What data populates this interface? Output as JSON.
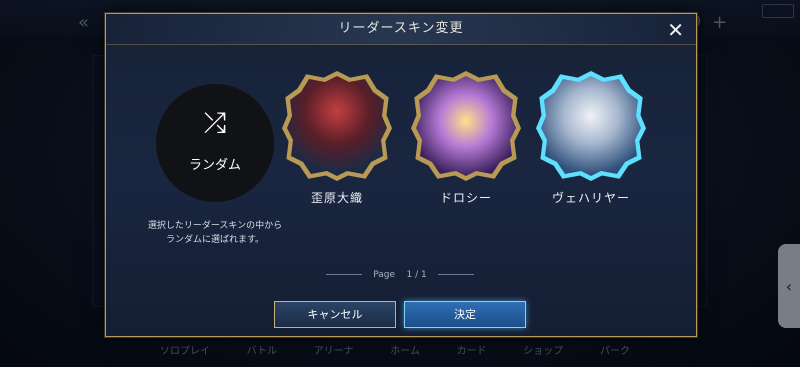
{
  "modal": {
    "title": "リーダースキン変更",
    "close_icon": "close-icon"
  },
  "options": [
    {
      "id": "random",
      "label": "ランダム",
      "icon": "shuffle-icon",
      "description": "選択したリーダースキンの中から\nランダムに選ばれます。"
    },
    {
      "id": "char1",
      "label": "歪原大織",
      "frame": "#b89a55",
      "selected": false
    },
    {
      "id": "char2",
      "label": "ドロシー",
      "frame": "#b89a55",
      "selected": false
    },
    {
      "id": "char3",
      "label": "ヴェハリヤー",
      "frame": "#5ee1ff",
      "selected": true
    }
  ],
  "pager": {
    "label": "Page",
    "current": "1",
    "sep": "/",
    "total": "1"
  },
  "buttons": {
    "cancel": "キャンセル",
    "confirm": "決定"
  },
  "background": {
    "nav": [
      "ソロプレイ",
      "バトル",
      "アリーナ",
      "ホーム",
      "カード",
      "ショップ",
      "パーク"
    ]
  }
}
